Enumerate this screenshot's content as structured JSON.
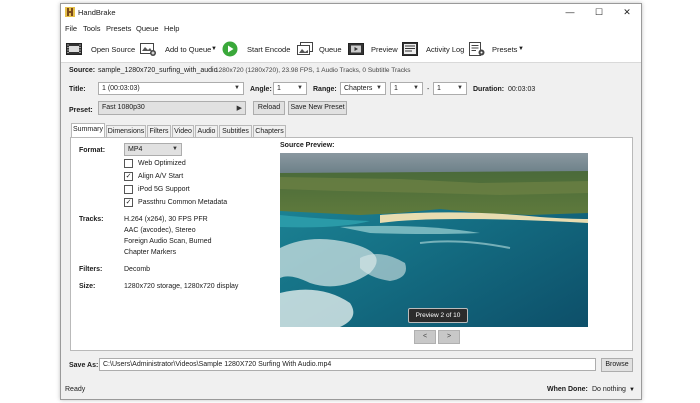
{
  "window": {
    "title": "HandBrake",
    "minimize": "—",
    "maximize": "☐",
    "close": "✕"
  },
  "menu": [
    "File",
    "Tools",
    "Presets",
    "Queue",
    "Help"
  ],
  "toolbar": {
    "open_source": "Open Source",
    "add_to_queue": "Add to Queue",
    "start_encode": "Start Encode",
    "queue": "Queue",
    "preview": "Preview",
    "activity_log": "Activity Log",
    "presets": "Presets"
  },
  "source": {
    "label": "Source:",
    "name": "sample_1280x720_surfing_with_audio",
    "info": "1280x720 (1280x720), 23.98 FPS, 1 Audio Tracks, 0 Subtitle Tracks"
  },
  "title_row": {
    "title_label": "Title:",
    "title_value": "1 (00:03:03)",
    "angle_label": "Angle:",
    "angle_value": "1",
    "range_label": "Range:",
    "range_value": "Chapters",
    "range_from": "1",
    "range_dash": "-",
    "range_to": "1",
    "duration_label": "Duration:",
    "duration_value": "00:03:03"
  },
  "preset": {
    "label": "Preset:",
    "value": "Fast 1080p30",
    "reload": "Reload",
    "save_new": "Save New Preset"
  },
  "tabs": [
    "Summary",
    "Dimensions",
    "Filters",
    "Video",
    "Audio",
    "Subtitles",
    "Chapters"
  ],
  "summary": {
    "format_label": "Format:",
    "format_value": "MP4",
    "options": [
      {
        "label": "Web Optimized",
        "checked": false
      },
      {
        "label": "Align A/V Start",
        "checked": true
      },
      {
        "label": "iPod 5G Support",
        "checked": false
      },
      {
        "label": "Passthru Common Metadata",
        "checked": true
      }
    ],
    "tracks_label": "Tracks:",
    "tracks": [
      "H.264 (x264), 30 FPS PFR",
      "AAC (avcodec), Stereo",
      "Foreign Audio Scan, Burned",
      "Chapter Markers"
    ],
    "filters_label": "Filters:",
    "filters_value": "Decomb",
    "size_label": "Size:",
    "size_value": "1280x720 storage, 1280x720 display",
    "preview_label": "Source Preview:",
    "preview_badge": "Preview 2 of 10",
    "prev": "<",
    "next": ">"
  },
  "save_as": {
    "label": "Save As:",
    "path": "C:\\Users\\Administrator\\Videos\\Sample 1280X720 Surfing With Audio.mp4",
    "browse": "Browse"
  },
  "status": {
    "text": "Ready",
    "when_done_label": "When Done:",
    "when_done_value": "Do nothing"
  },
  "colors": {
    "start_green": "#3aa83a",
    "check_blue": "#1a1a1a"
  }
}
